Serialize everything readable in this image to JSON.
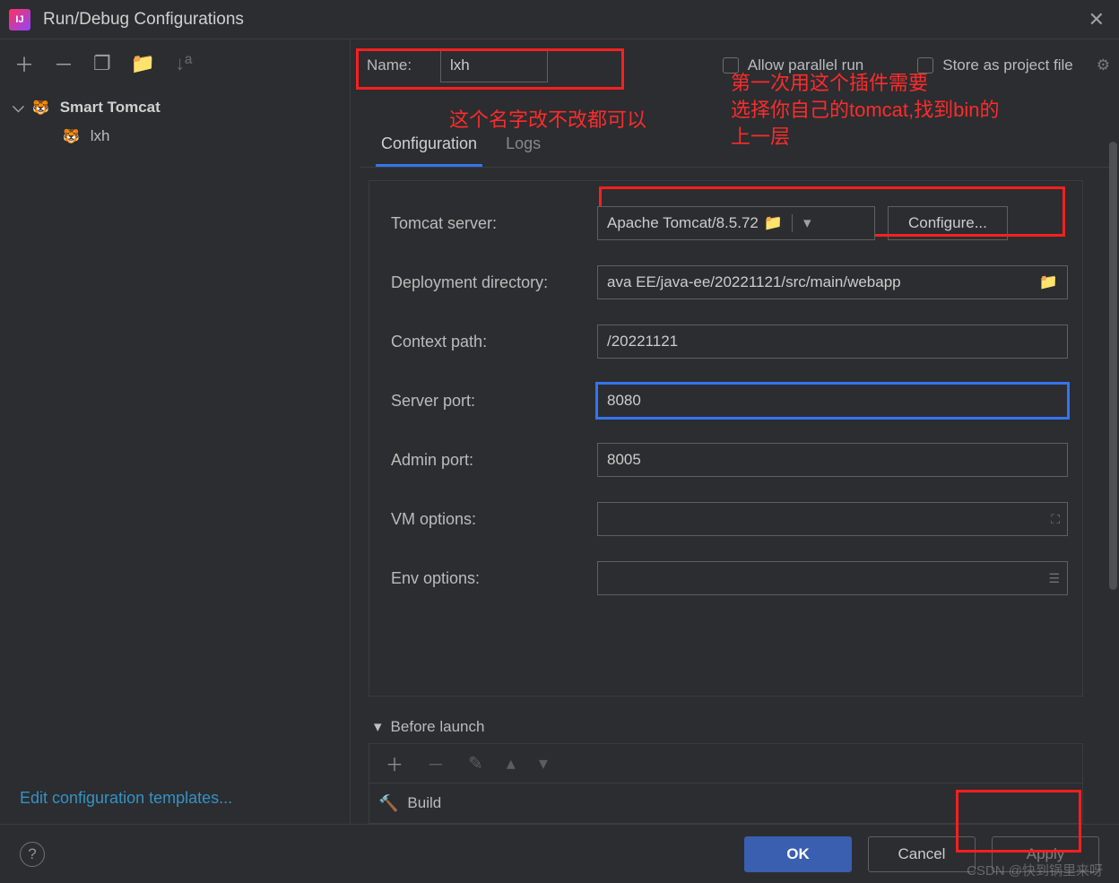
{
  "window": {
    "title": "Run/Debug Configurations"
  },
  "sidebar": {
    "group": "Smart Tomcat",
    "item": "lxh",
    "edit_templates": "Edit configuration templates..."
  },
  "header": {
    "name_label": "Name:",
    "name_value": "lxh",
    "allow_parallel": "Allow parallel run",
    "store_as_project": "Store as project file"
  },
  "tabs": {
    "configuration": "Configuration",
    "logs": "Logs"
  },
  "form": {
    "tomcat_server_label": "Tomcat server:",
    "tomcat_server_value": "Apache Tomcat/8.5.72",
    "configure_btn": "Configure...",
    "deployment_dir_label": "Deployment directory:",
    "deployment_dir_value": "ava EE/java-ee/20221121/src/main/webapp",
    "context_path_label": "Context path:",
    "context_path_value": "/20221121",
    "server_port_label": "Server port:",
    "server_port_value": "8080",
    "admin_port_label": "Admin port:",
    "admin_port_value": "8005",
    "vm_options_label": "VM options:",
    "vm_options_value": "",
    "env_options_label": "Env options:",
    "env_options_value": ""
  },
  "before_launch": {
    "title": "Before launch",
    "item": "Build"
  },
  "footer": {
    "ok": "OK",
    "cancel": "Cancel",
    "apply": "Apply"
  },
  "annotations": {
    "name_note": "这个名字改不改都可以",
    "plugin_note_l1": "第一次用这个插件需要",
    "plugin_note_l2": "选择你自己的tomcat,找到bin的",
    "plugin_note_l3": "上一层"
  },
  "watermark": "CSDN @快到锅里来呀"
}
